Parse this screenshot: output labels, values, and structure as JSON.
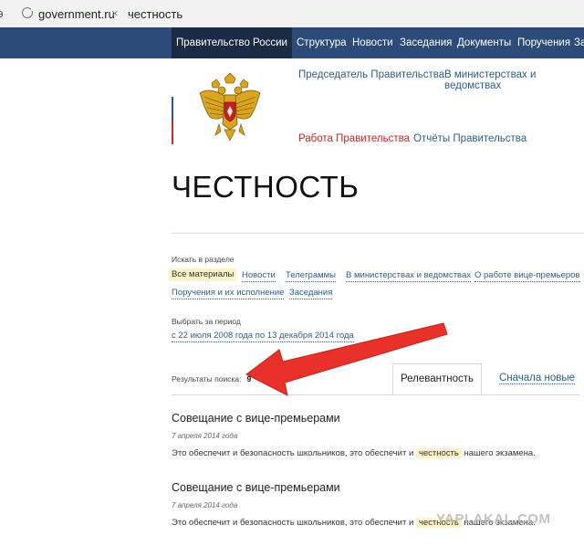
{
  "browser": {
    "partial_left": "э",
    "url": "government.ru",
    "close": "×",
    "query": "честность"
  },
  "topnav": {
    "brand": "Правительство России",
    "items": [
      "Структура",
      "Новости",
      "Заседания",
      "Документы",
      "Поручения",
      "За"
    ]
  },
  "subnav": {
    "chairman": "Председатель Правительства",
    "ministries": "В министерствах и ведомствах",
    "work": "Работа Правительства",
    "reports": "Отчёты Правительства"
  },
  "page_title": "ЧЕСТНОСТЬ",
  "section_filter": {
    "label": "Искать в разделе",
    "chips": [
      "Все материалы",
      "Новости",
      "Телеграммы",
      "В министерствах и ведомствах",
      "О работе вице-премьеров",
      "Поручения и их исполнение",
      "Заседания"
    ]
  },
  "period_filter": {
    "label": "Выбрать за период",
    "value": "с 22 июля 2008 года по 13 декабря 2014 года"
  },
  "results": {
    "label": "Результаты поиска:",
    "count": "9",
    "tabs": [
      "Релевантность",
      "Сначала новые"
    ],
    "items": [
      {
        "title": "Совещание с вице-премьерами",
        "date": "7 апреля 2014 года",
        "snippet_before": "Это обеспечит и безопасность школьников, это обеспечит и",
        "snippet_highlight": "честность",
        "snippet_after": "нашего экзамена."
      },
      {
        "title": "Совещание с вице-премьерами",
        "date": "7 апреля 2014 года",
        "snippet_before": "Это обеспечит и безопасность школьников, это обеспечит и",
        "snippet_highlight": "честность",
        "snippet_after": "нашего экзамена."
      }
    ]
  },
  "watermark": "YAPLAKAL.COM",
  "colors": {
    "header": "#2c4b78",
    "brand_bg": "#1a2b46",
    "link": "#2e5d8c",
    "active_link": "#cc2222",
    "highlight": "#fbf2c7",
    "arrow": "#e8312a"
  }
}
